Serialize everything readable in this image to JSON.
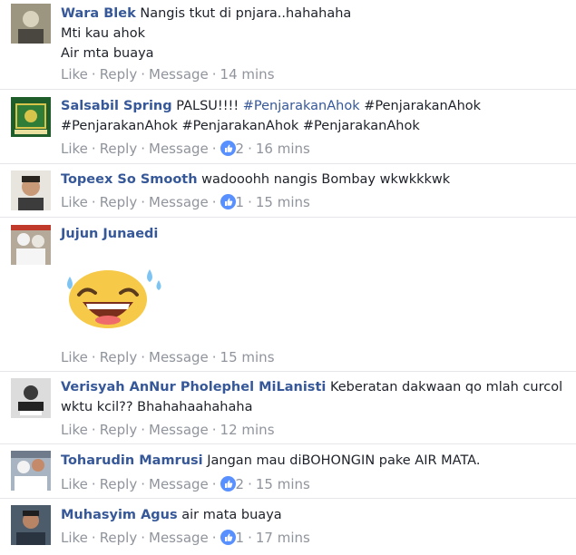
{
  "actions": {
    "like": "Like",
    "reply": "Reply",
    "message": "Message",
    "dot": "·"
  },
  "colors": {
    "name": "#365899",
    "meta": "#90949c",
    "text": "#1d2129",
    "like_blue": "#5890ff"
  },
  "comments": [
    {
      "name": "Wara Blek",
      "lines": [
        "Nangis tkut di pnjara..hahahaha",
        "Mti kau ahok",
        "Air mta buaya"
      ],
      "reactions": "",
      "time": "14 mins"
    },
    {
      "name": "Salsabil Spring",
      "text": "PALSU!!!!",
      "tags": [
        "#PenjarakanAhok",
        "#PenjarakanAhok",
        "#PenjarakanAhok",
        "#PenjarakanAhok",
        "#PenjarakanAhok"
      ],
      "reactions": "2",
      "time": "16 mins"
    },
    {
      "name": "Topeex So Smooth",
      "text": "wadooohh nangis Bombay wkwkkkwk",
      "reactions": "1",
      "time": "15 mins"
    },
    {
      "name": "Jujun Junaedi",
      "sticker": "laughing-tears-emoji",
      "reactions": "",
      "time": "15 mins"
    },
    {
      "name": "Verisyah AnNur Pholephel MiLanisti",
      "text": "Keberatan dakwaan qo mlah curcol",
      "text2": "wktu kcil?? Bhahahaahahaha",
      "reactions": "",
      "time": "12 mins"
    },
    {
      "name": "Toharudin Mamrusi",
      "text": "Jangan mau diBOHONGIN pake AIR MATA.",
      "reactions": "2",
      "time": "15 mins"
    },
    {
      "name": "Muhasyim Agus",
      "text": "air mata buaya",
      "reactions": "1",
      "time": "17 mins"
    }
  ]
}
